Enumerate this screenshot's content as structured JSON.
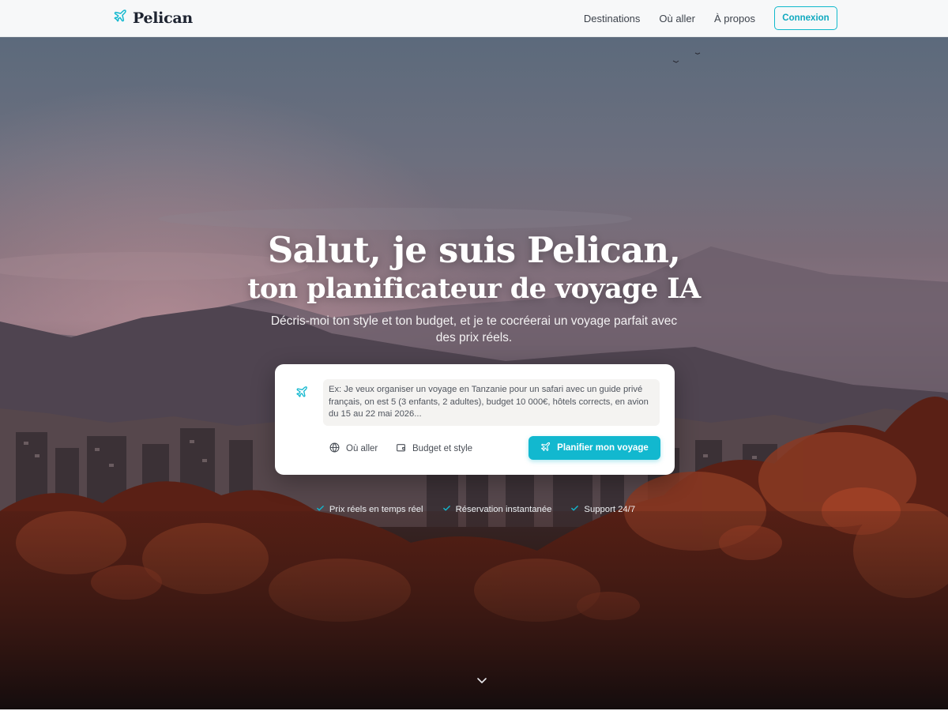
{
  "header": {
    "brand": "Pelican",
    "brand_icon": "plane-icon",
    "nav": [
      "Destinations",
      "Où aller",
      "À propos"
    ],
    "login_label": "Connexion"
  },
  "hero": {
    "title_line1": "Salut, je suis Pelican,",
    "title_line2": "ton planificateur de voyage IA",
    "subtitle": "Décris-moi ton style et ton budget, et je te cocréerai un voyage parfait avec des prix réels."
  },
  "planner": {
    "prompt_placeholder": "Ex: Je veux organiser un voyage en Tanzanie pour un safari avec un guide privé français, on est 5 (3 enfants, 2 adultes), budget 10 000€, hôtels corrects, en avion du 15 au 22 mai 2026...",
    "chip_where": "Où aller",
    "chip_budget": "Budget et style",
    "submit_label": "Planifier mon voyage"
  },
  "features": [
    "Prix réels en temps réel",
    "Réservation instantanée",
    "Support 24/7"
  ],
  "colors": {
    "accent": "#12b8cf",
    "text_dark": "#1d2330"
  }
}
